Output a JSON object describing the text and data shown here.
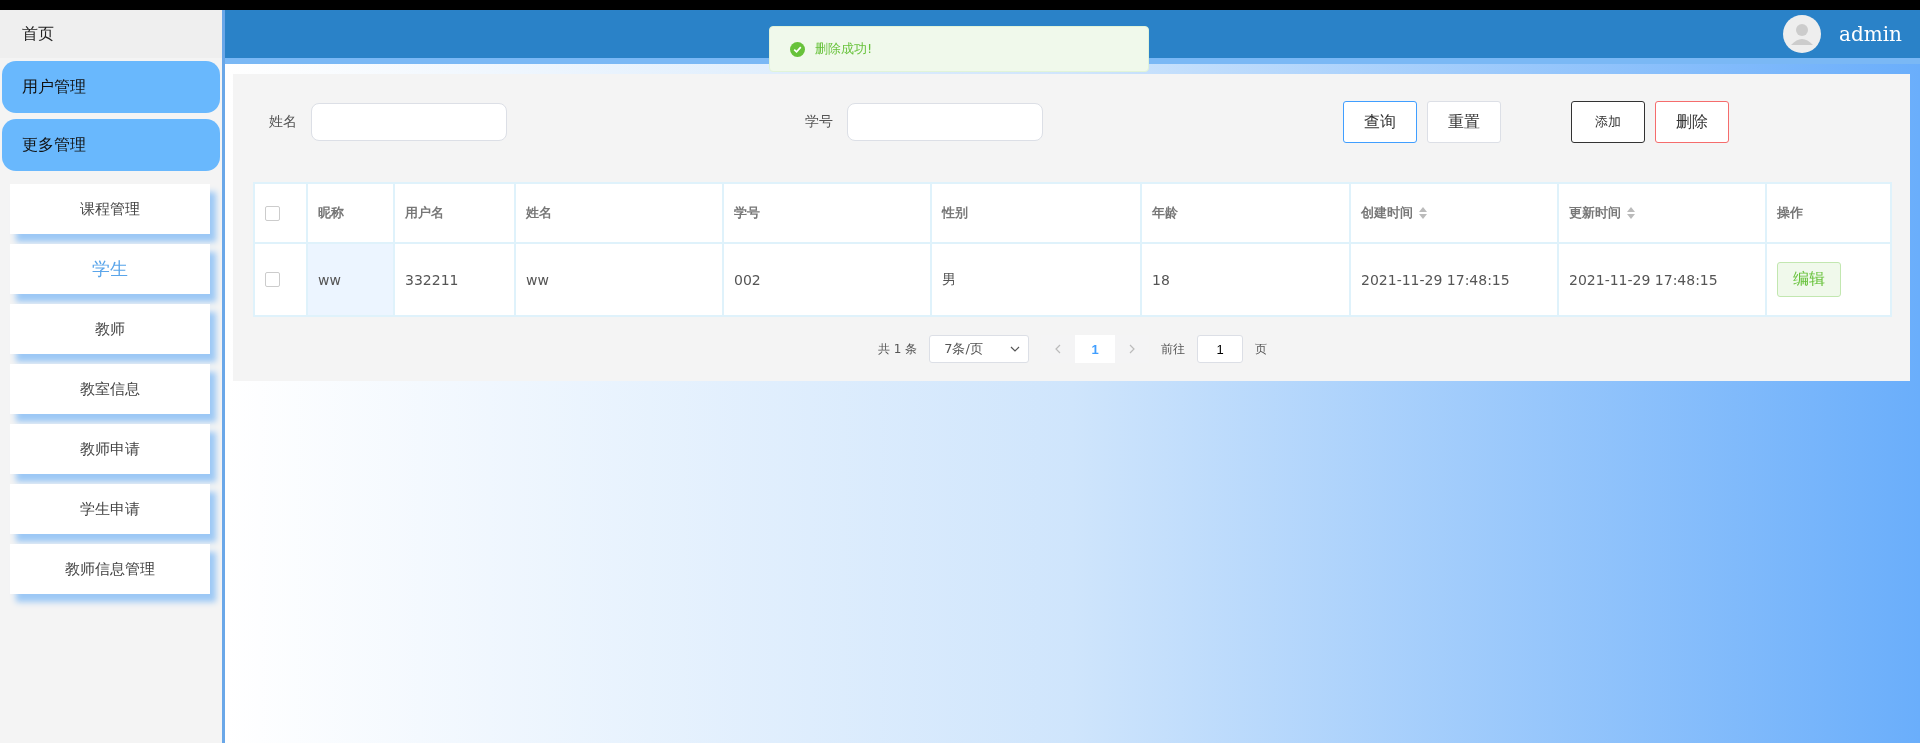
{
  "sidebar": {
    "home": "首页",
    "groups": [
      {
        "label": "用户管理"
      },
      {
        "label": "更多管理"
      }
    ],
    "items": [
      {
        "label": "课程管理",
        "selected": false
      },
      {
        "label": "学生",
        "selected": true
      },
      {
        "label": "教师",
        "selected": false
      },
      {
        "label": "教室信息",
        "selected": false
      },
      {
        "label": "教师申请",
        "selected": false
      },
      {
        "label": "学生申请",
        "selected": false
      },
      {
        "label": "教师信息管理",
        "selected": false
      }
    ]
  },
  "header": {
    "user": "admin"
  },
  "toast": {
    "message": "删除成功!"
  },
  "search": {
    "fields": [
      {
        "label": "姓名"
      },
      {
        "label": "学号"
      }
    ],
    "buttons": [
      {
        "label": "查询",
        "kind": "primary"
      },
      {
        "label": "重置",
        "kind": "plain"
      },
      {
        "label": "添加",
        "kind": "dark"
      },
      {
        "label": "删除",
        "kind": "danger"
      }
    ]
  },
  "table": {
    "select_all_checked": false,
    "columns": [
      {
        "label": "昵称",
        "sortable": false
      },
      {
        "label": "用户名",
        "sortable": false
      },
      {
        "label": "姓名",
        "sortable": false
      },
      {
        "label": "学号",
        "sortable": false
      },
      {
        "label": "性别",
        "sortable": false
      },
      {
        "label": "年龄",
        "sortable": false
      },
      {
        "label": "创建时间",
        "sortable": true
      },
      {
        "label": "更新时间",
        "sortable": true
      },
      {
        "label": "操作",
        "sortable": false
      }
    ],
    "rows": [
      {
        "checked": false,
        "cells": [
          "ww",
          "332211",
          "ww",
          "002",
          "男",
          "18",
          "2021-11-29 17:48:15",
          "2021-11-29 17:48:15"
        ],
        "action": "编辑"
      }
    ]
  },
  "pagination": {
    "total": "共 1 条",
    "page_size": "7条/页",
    "pages": [
      {
        "label": "1",
        "selected": true
      }
    ],
    "goto_label": "前往",
    "goto_value": "1",
    "goto_suffix": "页"
  }
}
